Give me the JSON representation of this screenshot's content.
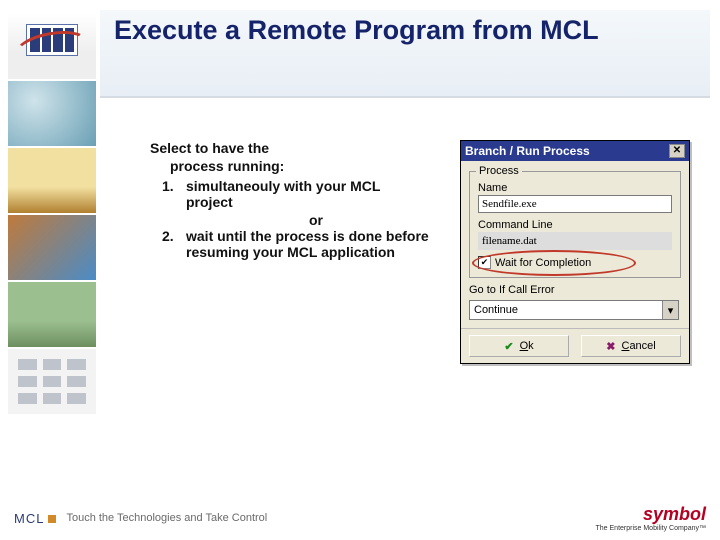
{
  "title": "Execute a Remote Program from MCL",
  "content": {
    "lead": "Select to have the",
    "lead2": "process running:",
    "item1_num": "1.",
    "item1_txt": "simultaneouly with your MCL project",
    "or": "or",
    "item2_num": "2.",
    "item2_txt": "wait until the process is done before resuming your MCL application"
  },
  "dialog": {
    "title": "Branch / Run Process",
    "group_legend": "Process",
    "name_label": "Name",
    "name_value": "Sendfile.exe",
    "cmd_label": "Command Line",
    "cmd_value": "filename.dat",
    "wait_check": "✔",
    "wait_label": "Wait for Completion",
    "goto_label": "Go to If Call Error",
    "select_value": "Continue",
    "ok_letter": "O",
    "ok_rest": "k",
    "cancel_letter": "C",
    "cancel_rest": "ancel"
  },
  "footer": {
    "mcl": "MCL",
    "tagline": "Touch the Technologies and Take Control",
    "symbol": "symbol",
    "symbol_sub": "The Enterprise Mobility Company™"
  }
}
